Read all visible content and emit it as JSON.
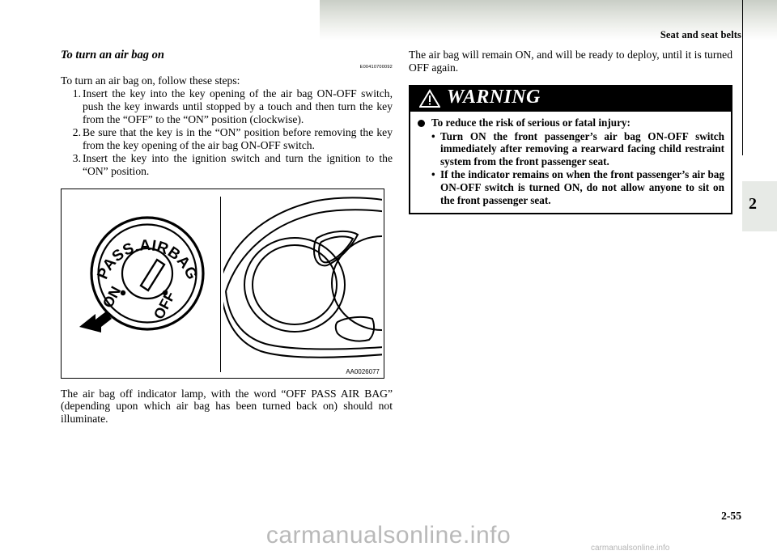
{
  "page": {
    "header_title": "Seat and seat belts",
    "section_tab_number": "2",
    "page_number": "2-55",
    "watermark_large": "carmanualsonline.info",
    "watermark_small": "carmanualsonline.info"
  },
  "left_column": {
    "heading": "To turn an air bag on",
    "reference_code": "E00410700092",
    "intro_paragraph": "To turn an air bag on, follow these steps:",
    "steps": [
      {
        "number": "1.",
        "text": "Insert the key into the key opening of the air bag ON-OFF switch, push the key inwards until stopped by a touch and then turn the key from the “OFF” to the “ON” position (clockwise)."
      },
      {
        "number": "2.",
        "text": "Be sure that the key is in the “ON” position before removing the key from the key opening of the air bag ON-OFF switch."
      },
      {
        "number": "3.",
        "text": "Insert the key into the ignition switch and turn the ignition to the “ON” position."
      }
    ],
    "figure": {
      "code": "AA0026077",
      "dial_label": "PASS.AIRBAG",
      "dial_position_on": "ON",
      "dial_position_off": "OFF"
    },
    "closing_paragraph": "The air bag off indicator lamp, with the word “OFF PASS AIR BAG” (depending upon which air bag has been turned back on) should not illuminate."
  },
  "right_column": {
    "intro_paragraph": "The air bag will remain ON, and will be ready to deploy, until it is turned OFF again.",
    "warning": {
      "title": "WARNING",
      "lead": "To reduce the risk of serious or fatal injury:",
      "bullets": [
        "Turn ON the front passenger’s air bag ON-OFF switch immediately after removing a rearward facing child restraint system from the front passenger seat.",
        "If the indicator remains on when the front passenger’s air bag ON-OFF switch is turned ON, do not allow anyone to sit on the front passenger seat."
      ],
      "bullet_marker": "•"
    }
  },
  "colors": {
    "warning_header_bg": "#000000",
    "warning_header_text": "#ffffff",
    "side_tab_bg": "#e7eae6",
    "watermark": "#b9b9b9"
  }
}
